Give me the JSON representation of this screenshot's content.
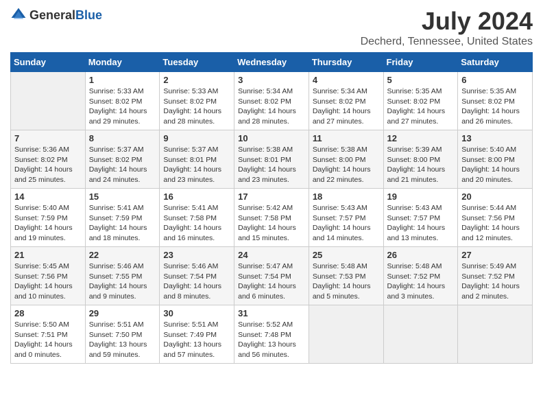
{
  "logo": {
    "general": "General",
    "blue": "Blue"
  },
  "title": "July 2024",
  "subtitle": "Decherd, Tennessee, United States",
  "days_header": [
    "Sunday",
    "Monday",
    "Tuesday",
    "Wednesday",
    "Thursday",
    "Friday",
    "Saturday"
  ],
  "weeks": [
    [
      {
        "num": "",
        "info": ""
      },
      {
        "num": "1",
        "info": "Sunrise: 5:33 AM\nSunset: 8:02 PM\nDaylight: 14 hours\nand 29 minutes."
      },
      {
        "num": "2",
        "info": "Sunrise: 5:33 AM\nSunset: 8:02 PM\nDaylight: 14 hours\nand 28 minutes."
      },
      {
        "num": "3",
        "info": "Sunrise: 5:34 AM\nSunset: 8:02 PM\nDaylight: 14 hours\nand 28 minutes."
      },
      {
        "num": "4",
        "info": "Sunrise: 5:34 AM\nSunset: 8:02 PM\nDaylight: 14 hours\nand 27 minutes."
      },
      {
        "num": "5",
        "info": "Sunrise: 5:35 AM\nSunset: 8:02 PM\nDaylight: 14 hours\nand 27 minutes."
      },
      {
        "num": "6",
        "info": "Sunrise: 5:35 AM\nSunset: 8:02 PM\nDaylight: 14 hours\nand 26 minutes."
      }
    ],
    [
      {
        "num": "7",
        "info": "Sunrise: 5:36 AM\nSunset: 8:02 PM\nDaylight: 14 hours\nand 25 minutes."
      },
      {
        "num": "8",
        "info": "Sunrise: 5:37 AM\nSunset: 8:02 PM\nDaylight: 14 hours\nand 24 minutes."
      },
      {
        "num": "9",
        "info": "Sunrise: 5:37 AM\nSunset: 8:01 PM\nDaylight: 14 hours\nand 23 minutes."
      },
      {
        "num": "10",
        "info": "Sunrise: 5:38 AM\nSunset: 8:01 PM\nDaylight: 14 hours\nand 23 minutes."
      },
      {
        "num": "11",
        "info": "Sunrise: 5:38 AM\nSunset: 8:00 PM\nDaylight: 14 hours\nand 22 minutes."
      },
      {
        "num": "12",
        "info": "Sunrise: 5:39 AM\nSunset: 8:00 PM\nDaylight: 14 hours\nand 21 minutes."
      },
      {
        "num": "13",
        "info": "Sunrise: 5:40 AM\nSunset: 8:00 PM\nDaylight: 14 hours\nand 20 minutes."
      }
    ],
    [
      {
        "num": "14",
        "info": "Sunrise: 5:40 AM\nSunset: 7:59 PM\nDaylight: 14 hours\nand 19 minutes."
      },
      {
        "num": "15",
        "info": "Sunrise: 5:41 AM\nSunset: 7:59 PM\nDaylight: 14 hours\nand 18 minutes."
      },
      {
        "num": "16",
        "info": "Sunrise: 5:41 AM\nSunset: 7:58 PM\nDaylight: 14 hours\nand 16 minutes."
      },
      {
        "num": "17",
        "info": "Sunrise: 5:42 AM\nSunset: 7:58 PM\nDaylight: 14 hours\nand 15 minutes."
      },
      {
        "num": "18",
        "info": "Sunrise: 5:43 AM\nSunset: 7:57 PM\nDaylight: 14 hours\nand 14 minutes."
      },
      {
        "num": "19",
        "info": "Sunrise: 5:43 AM\nSunset: 7:57 PM\nDaylight: 14 hours\nand 13 minutes."
      },
      {
        "num": "20",
        "info": "Sunrise: 5:44 AM\nSunset: 7:56 PM\nDaylight: 14 hours\nand 12 minutes."
      }
    ],
    [
      {
        "num": "21",
        "info": "Sunrise: 5:45 AM\nSunset: 7:56 PM\nDaylight: 14 hours\nand 10 minutes."
      },
      {
        "num": "22",
        "info": "Sunrise: 5:46 AM\nSunset: 7:55 PM\nDaylight: 14 hours\nand 9 minutes."
      },
      {
        "num": "23",
        "info": "Sunrise: 5:46 AM\nSunset: 7:54 PM\nDaylight: 14 hours\nand 8 minutes."
      },
      {
        "num": "24",
        "info": "Sunrise: 5:47 AM\nSunset: 7:54 PM\nDaylight: 14 hours\nand 6 minutes."
      },
      {
        "num": "25",
        "info": "Sunrise: 5:48 AM\nSunset: 7:53 PM\nDaylight: 14 hours\nand 5 minutes."
      },
      {
        "num": "26",
        "info": "Sunrise: 5:48 AM\nSunset: 7:52 PM\nDaylight: 14 hours\nand 3 minutes."
      },
      {
        "num": "27",
        "info": "Sunrise: 5:49 AM\nSunset: 7:52 PM\nDaylight: 14 hours\nand 2 minutes."
      }
    ],
    [
      {
        "num": "28",
        "info": "Sunrise: 5:50 AM\nSunset: 7:51 PM\nDaylight: 14 hours\nand 0 minutes."
      },
      {
        "num": "29",
        "info": "Sunrise: 5:51 AM\nSunset: 7:50 PM\nDaylight: 13 hours\nand 59 minutes."
      },
      {
        "num": "30",
        "info": "Sunrise: 5:51 AM\nSunset: 7:49 PM\nDaylight: 13 hours\nand 57 minutes."
      },
      {
        "num": "31",
        "info": "Sunrise: 5:52 AM\nSunset: 7:48 PM\nDaylight: 13 hours\nand 56 minutes."
      },
      {
        "num": "",
        "info": ""
      },
      {
        "num": "",
        "info": ""
      },
      {
        "num": "",
        "info": ""
      }
    ]
  ]
}
